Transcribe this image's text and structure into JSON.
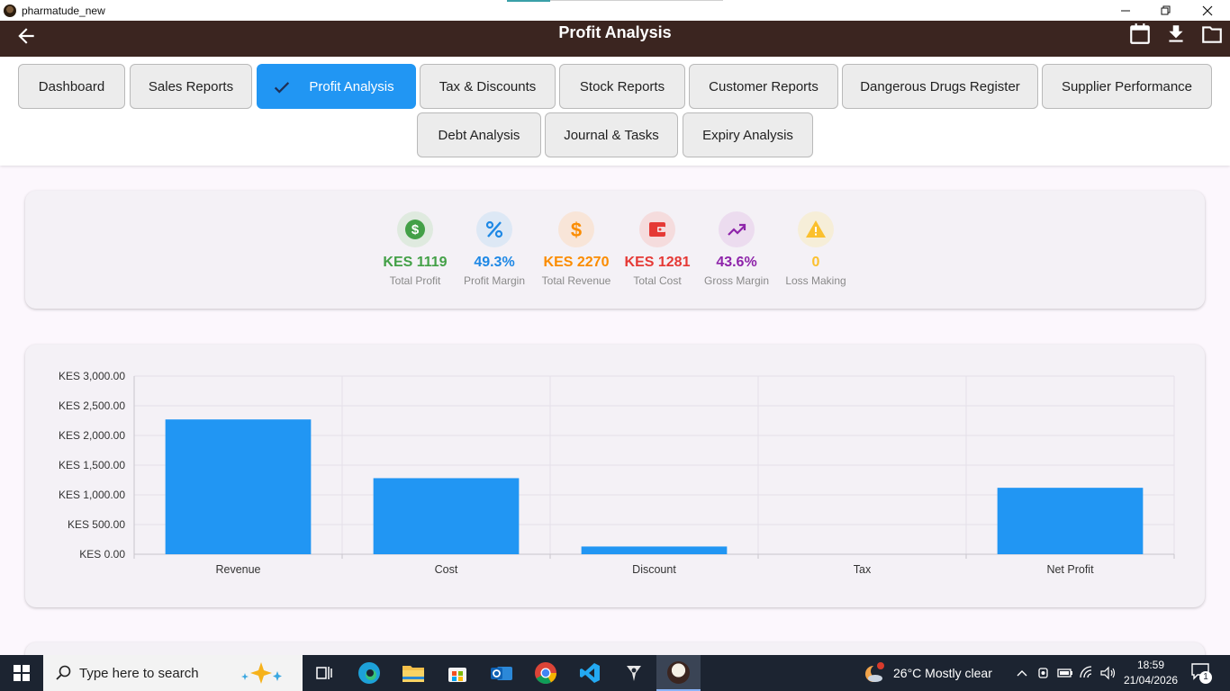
{
  "window": {
    "title": "pharmatude_new"
  },
  "appbar": {
    "title": "Profit Analysis"
  },
  "nav": {
    "tabs": [
      {
        "label": "Dashboard"
      },
      {
        "label": "Sales Reports"
      },
      {
        "label": "Profit Analysis",
        "active": true
      },
      {
        "label": "Tax & Discounts"
      },
      {
        "label": "Stock Reports"
      },
      {
        "label": "Customer Reports"
      },
      {
        "label": "Dangerous Drugs Register"
      },
      {
        "label": "Supplier Performance"
      },
      {
        "label": "Debt Analysis"
      },
      {
        "label": "Journal & Tasks"
      },
      {
        "label": "Expiry Analysis"
      }
    ]
  },
  "kpis": [
    {
      "value": "KES 1119",
      "label": "Total Profit",
      "icon": "dollar-circle-icon",
      "color": "#43a047",
      "bg": "#dfeadf"
    },
    {
      "value": "49.3%",
      "label": "Profit Margin",
      "icon": "percent-icon",
      "color": "#1e88e5",
      "bg": "#dde8f5"
    },
    {
      "value": "KES 2270",
      "label": "Total Revenue",
      "icon": "dollar-icon",
      "color": "#fb8c00",
      "bg": "#f8e5d8"
    },
    {
      "value": "KES 1281",
      "label": "Total Cost",
      "icon": "wallet-icon",
      "color": "#e53935",
      "bg": "#f5dcdd"
    },
    {
      "value": "43.6%",
      "label": "Gross Margin",
      "icon": "trending-up-icon",
      "color": "#8e24aa",
      "bg": "#ecdcef"
    },
    {
      "value": "0",
      "label": "Loss Making",
      "icon": "warning-icon",
      "color": "#fbc02d",
      "bg": "#f6eed8"
    }
  ],
  "chart_data": {
    "type": "bar",
    "categories": [
      "Revenue",
      "Cost",
      "Discount",
      "Tax",
      "Net Profit"
    ],
    "values": [
      2270,
      1281,
      130,
      0,
      1119
    ],
    "ylim": [
      0,
      3000
    ],
    "yticks": [
      "KES 0.00",
      "KES 500.00",
      "KES 1,000.00",
      "KES 1,500.00",
      "KES 2,000.00",
      "KES 2,500.00",
      "KES 3,000.00"
    ],
    "bar_color": "#2196f3",
    "grid": true
  },
  "taskbar": {
    "search_placeholder": "Type here to search",
    "weather": "26°C  Mostly clear",
    "time": "18:59",
    "date": "21/04/2026",
    "notifications": "1"
  }
}
